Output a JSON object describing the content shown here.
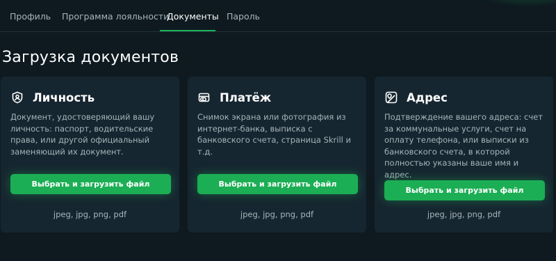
{
  "tabs": [
    {
      "label": "Профиль"
    },
    {
      "label": "Программа лояльности"
    },
    {
      "label": "Документы"
    },
    {
      "label": "Пароль"
    }
  ],
  "active_tab": "Документы",
  "page_title": "Загрузка документов",
  "accent_color": "#1cae54",
  "cards": [
    {
      "icon": "identity-badge-icon",
      "title": "Личность",
      "description": "Документ, удостоверяющий вашу личность: паспорт, водительские права, или другой официальный заменяющий их документ.",
      "button_label": "Выбрать и загрузить файл",
      "formats": "jpeg, jpg, png, pdf"
    },
    {
      "icon": "payment-card-icon",
      "title": "Платёж",
      "description": "Снимок экрана или фотография из интернет-банка, выписка с банковского счета, страница Skrill и т.д.",
      "button_label": "Выбрать и загрузить файл",
      "formats": "jpeg, jpg, png, pdf"
    },
    {
      "icon": "address-map-icon",
      "title": "Адрес",
      "description": "Подтверждение вашего адреса: счет за коммунальные услуги, счет на оплату телефона, или выписки из банковского счета, в которой полностью указаны ваше имя и адрес.",
      "button_label": "Выбрать и загрузить файл",
      "formats": "jpeg, jpg, png, pdf"
    }
  ]
}
